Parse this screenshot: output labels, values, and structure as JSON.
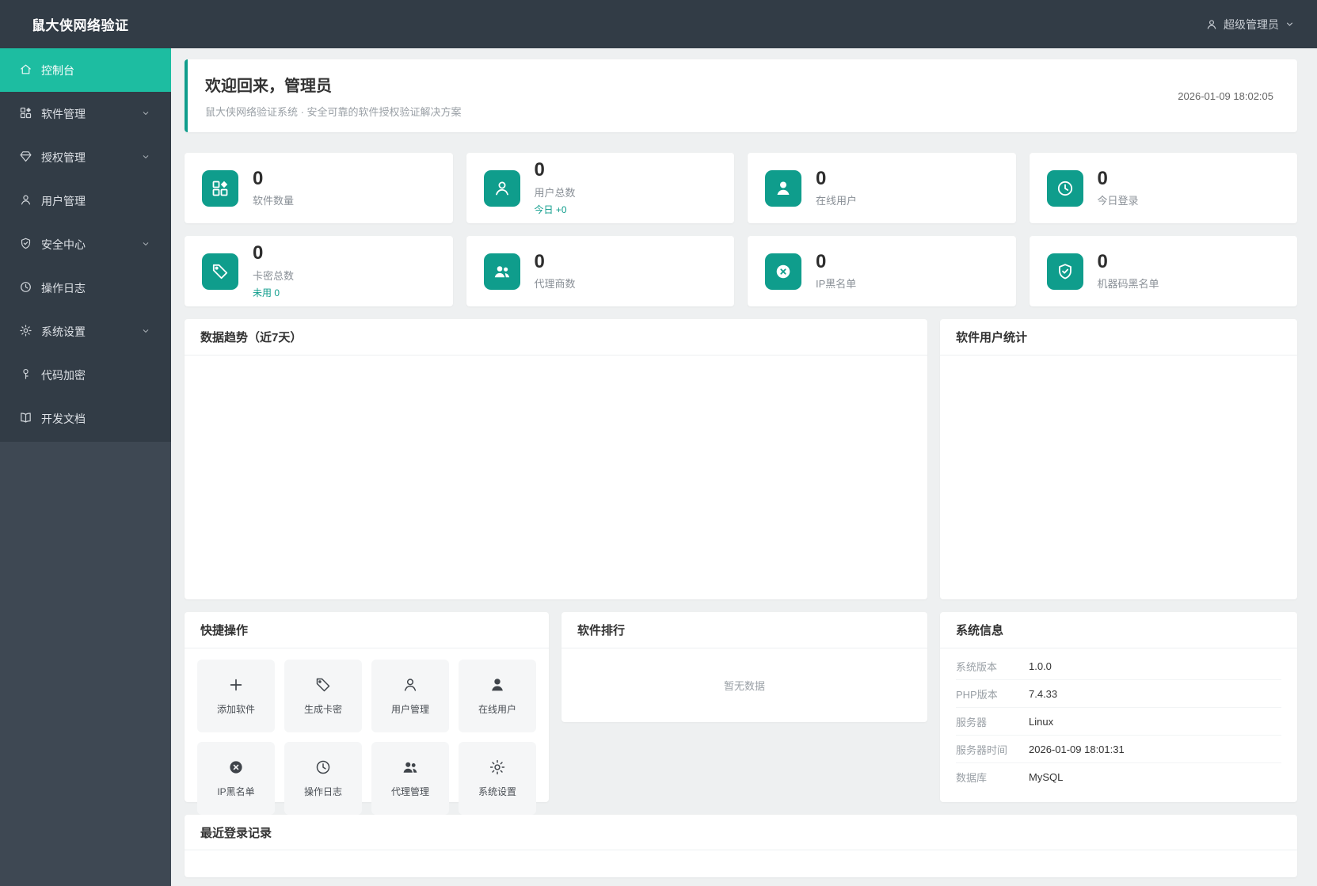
{
  "app": {
    "title": "鼠大侠网络验证"
  },
  "topbar": {
    "user": "超级管理员"
  },
  "sidebar": {
    "items": [
      {
        "label": "控制台"
      },
      {
        "label": "软件管理"
      },
      {
        "label": "授权管理"
      },
      {
        "label": "用户管理"
      },
      {
        "label": "安全中心"
      },
      {
        "label": "操作日志"
      },
      {
        "label": "系统设置"
      },
      {
        "label": "代码加密"
      },
      {
        "label": "开发文档"
      }
    ]
  },
  "welcome": {
    "title": "欢迎回来，管理员",
    "subtitle": "鼠大侠网络验证系统 · 安全可靠的软件授权验证解决方案",
    "timestamp": "2026-01-09 18:02:05"
  },
  "stats": [
    {
      "value": "0",
      "label": "软件数量",
      "sub": ""
    },
    {
      "value": "0",
      "label": "用户总数",
      "sub": "今日 +0"
    },
    {
      "value": "0",
      "label": "在线用户",
      "sub": ""
    },
    {
      "value": "0",
      "label": "今日登录",
      "sub": ""
    },
    {
      "value": "0",
      "label": "卡密总数",
      "sub": "未用 0"
    },
    {
      "value": "0",
      "label": "代理商数",
      "sub": ""
    },
    {
      "value": "0",
      "label": "IP黑名单",
      "sub": ""
    },
    {
      "value": "0",
      "label": "机器码黑名单",
      "sub": ""
    }
  ],
  "charts": {
    "trend_title": "数据趋势（近7天）",
    "user_stats_title": "软件用户统计"
  },
  "quick_actions": {
    "title": "快捷操作",
    "items": [
      {
        "label": "添加软件"
      },
      {
        "label": "生成卡密"
      },
      {
        "label": "用户管理"
      },
      {
        "label": "在线用户"
      },
      {
        "label": "IP黑名单"
      },
      {
        "label": "操作日志"
      },
      {
        "label": "代理管理"
      },
      {
        "label": "系统设置"
      }
    ]
  },
  "ranking": {
    "title": "软件排行",
    "empty_text": "暂无数据"
  },
  "system_info": {
    "title": "系统信息",
    "rows": [
      {
        "label": "系统版本",
        "value": "1.0.0"
      },
      {
        "label": "PHP版本",
        "value": "7.4.33"
      },
      {
        "label": "服务器",
        "value": "Linux"
      },
      {
        "label": "服务器时间",
        "value": "2026-01-09 18:01:31"
      },
      {
        "label": "数据库",
        "value": "MySQL"
      }
    ]
  },
  "recent_logins": {
    "title": "最近登录记录"
  },
  "colors": {
    "primary_teal": "#0f9d8c",
    "active_menu_teal": "#1dbda1",
    "topbar_dark": "#323c46",
    "sidebar_dark": "#3e4853",
    "page_bg": "#eef0f1"
  }
}
